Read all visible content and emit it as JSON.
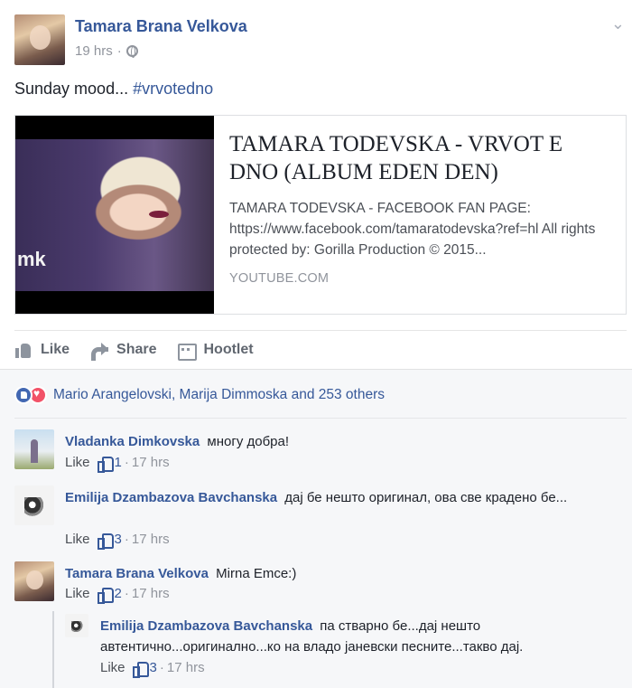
{
  "post": {
    "author": "Tamara Brana Velkova",
    "time": "19 hrs",
    "dot": "·",
    "status_text": "Sunday mood...",
    "hashtag": "#vrvotedno",
    "menu_glyph": "⌄"
  },
  "link_card": {
    "title": "TAMARA TODEVSKA - VRVOT E DNO (ALBUM EDEN DEN)",
    "description": "TAMARA TODEVSKA - FACEBOOK FAN PAGE: https://www.facebook.com/tamaratodevska?ref=hl All rights protected by: Gorilla Production © 2015...",
    "domain": "YOUTUBE.COM",
    "thumb_brand": "mk"
  },
  "actions": {
    "like": "Like",
    "share": "Share",
    "hootlet": "Hootlet"
  },
  "reactions": {
    "summary": "Mario Arangelovski, Marija Dimmoska and 253 others"
  },
  "comments": [
    {
      "name": "Vladanka Dimkovska",
      "text": "многу добра!",
      "like": "Like",
      "likes": "1",
      "time": "17 hrs",
      "dot": "·"
    },
    {
      "name": "Emilija Dzambazova Bavchanska",
      "text": "дај бе нешто оригинал, ова све крадено бе...",
      "like": "Like",
      "likes": "3",
      "time": "17 hrs",
      "dot": "·"
    },
    {
      "name": "Tamara Brana Velkova",
      "text": "Mirna Emce:)",
      "like": "Like",
      "likes": "2",
      "time": "17 hrs",
      "dot": "·"
    },
    {
      "name": "Emilija Dzambazova Bavchanska",
      "text": "па стварно бе...дај нешто автентично...оригинално...ко на владо јаневски песните...такво дај.",
      "like": "Like",
      "likes": "3",
      "time": "17 hrs",
      "dot": "·"
    }
  ],
  "colors": {
    "link_blue": "#365899",
    "meta_gray": "#90949c",
    "like_blue": "#4267b2",
    "love_red": "#f25268"
  }
}
